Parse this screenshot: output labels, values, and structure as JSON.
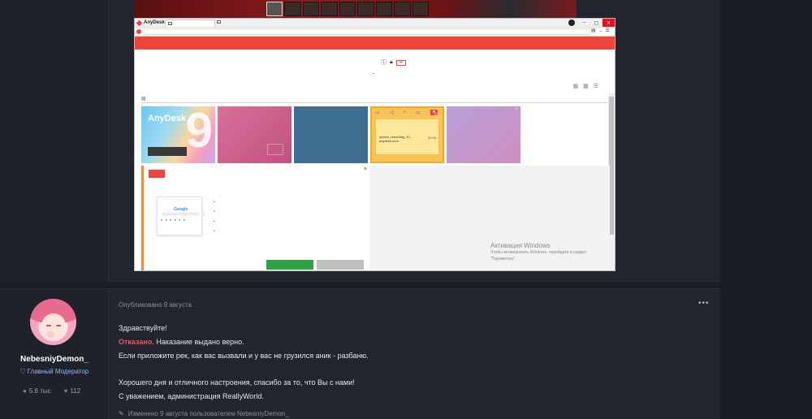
{
  "screenshot": {
    "app_title": "AnyDesk",
    "tile_brand": "AnyDesk",
    "tile_number": "9",
    "tile_file_name": "screen_recording_20...",
    "tile_file_sub": "anydesk.num",
    "tile_file_size": "02:06",
    "activation_title": "Активация Windows",
    "activation_text_1": "Чтобы активировать Windows, перейдите в раздел",
    "activation_text_2": "\"Параметры\".",
    "google_text": "Google",
    "window_controls": [
      "–",
      "▢",
      "✕"
    ]
  },
  "post": {
    "username": "NebesniyDemon_",
    "role": "Главный Модератор",
    "stats": {
      "messages": "5.6 тыс",
      "likes": "112"
    },
    "published": "Опубликовано 9 августа",
    "menu": "•••",
    "greeting": "Здравствуйте!",
    "refused": "Отказано",
    "verdict_rest": ". Наказание выдано верно.",
    "line2": "Если приложите рек, как вас вызвали и у вас не грузился аник - разбаню.",
    "line3": "Хорошего дня и отличного настроения, спасибо за то, что Вы с нами!",
    "signature": "С уважением, администрация ReallyWorld.",
    "edited": "Изменено 9 августа пользователем NebesniyDemon_"
  },
  "colors": {
    "background": "#1b1d24",
    "post_bg": "#23252e",
    "refused": "#f0565a",
    "role": "#8fb7ff",
    "anydesk_red": "#ef443b"
  }
}
